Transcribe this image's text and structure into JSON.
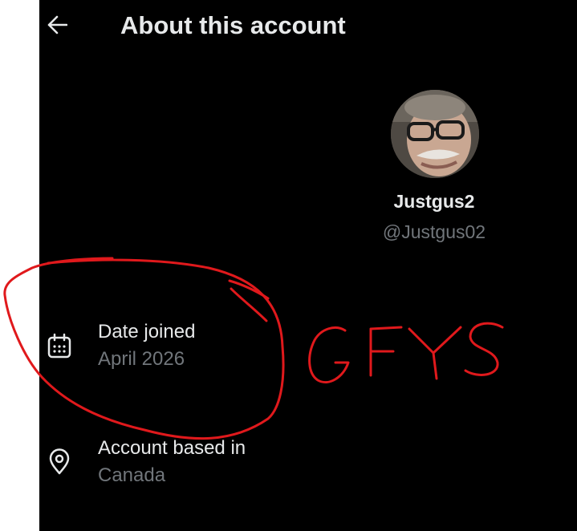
{
  "header": {
    "title": "About this account",
    "back_icon": "arrow-left-icon"
  },
  "profile": {
    "display_name": "Justgus2",
    "handle": "@Justgus02"
  },
  "rows": [
    {
      "icon": "calendar-icon",
      "label": "Date joined",
      "value": "April 2026"
    },
    {
      "icon": "location-pin-icon",
      "label": "Account based in",
      "value": "Canada"
    }
  ],
  "annotation": {
    "text": "GFYS",
    "color": "#e0191c"
  },
  "colors": {
    "background": "#000000",
    "primary_text": "#e7e9ea",
    "secondary_text": "#71767b"
  }
}
